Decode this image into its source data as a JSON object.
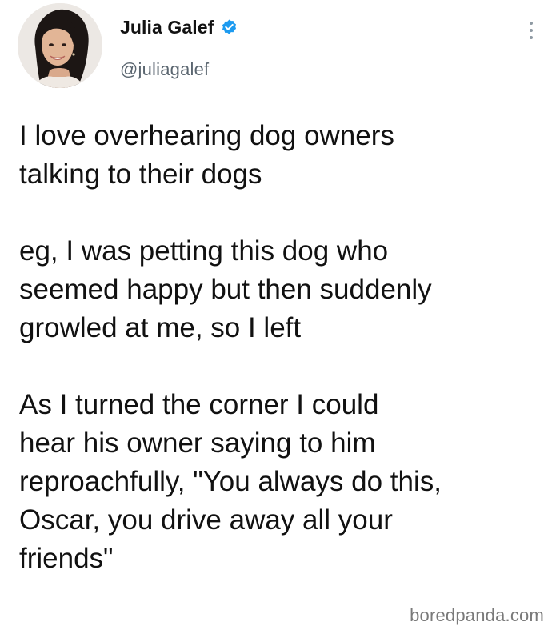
{
  "author": {
    "display_name": "Julia Galef",
    "handle": "@juliagalef",
    "verified": true,
    "verified_color": "#1d9bf0"
  },
  "tweet": {
    "paragraphs": [
      "I love overhearing dog owners\ntalking to their dogs",
      "eg, I was petting this dog who\nseemed happy but then suddenly\ngrowled at me, so I left",
      "As I turned the corner I could\nhear his owner saying to him\nreproachfully, \"You always do this,\nOscar, you drive away all your\nfriends\""
    ]
  },
  "icons": {
    "avatar": "profile-photo",
    "verified": "verified-badge-icon",
    "more": "more-options-icon"
  },
  "watermark": {
    "text": "boredpanda.com"
  }
}
